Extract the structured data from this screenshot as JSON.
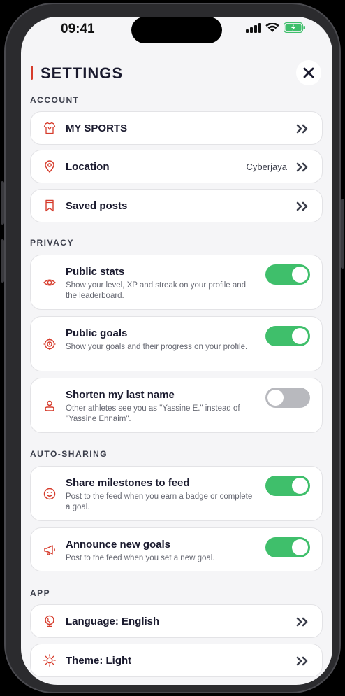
{
  "status": {
    "time": "09:41"
  },
  "header": {
    "title": "SETTINGS"
  },
  "sections": {
    "account": "ACCOUNT",
    "privacy": "PRIVACY",
    "auto_sharing": "AUTO-SHARING",
    "app": "APP"
  },
  "account": {
    "my_sports": {
      "label": "MY SPORTS",
      "icon": "jersey-icon"
    },
    "location": {
      "label": "Location",
      "value": "Cyberjaya",
      "icon": "location-pin-icon"
    },
    "saved_posts": {
      "label": "Saved posts",
      "icon": "bookmark-icon"
    }
  },
  "privacy": {
    "public_stats": {
      "label": "Public stats",
      "desc": "Show your level, XP and streak on your profile and the leaderboard.",
      "enabled": true,
      "icon": "eye-icon"
    },
    "public_goals": {
      "label": "Public goals",
      "desc": "Show your goals and their progress on your profile.",
      "enabled": true,
      "icon": "target-icon"
    },
    "shorten_name": {
      "label": "Shorten my last name",
      "desc": "Other athletes see you as \"Yassine E.\" instead of \"Yassine Ennaim\".",
      "enabled": false,
      "icon": "person-icon"
    }
  },
  "auto_sharing": {
    "share_milestones": {
      "label": "Share milestones to feed",
      "desc": "Post to the feed when you earn a badge or complete a goal.",
      "enabled": true,
      "icon": "smiley-icon"
    },
    "announce_goals": {
      "label": "Announce new goals",
      "desc": "Post to the feed when you set a new goal.",
      "enabled": true,
      "icon": "megaphone-icon"
    }
  },
  "app": {
    "language": {
      "label": "Language: English",
      "icon": "globe-icon"
    },
    "theme": {
      "label": "Theme: Light",
      "icon": "sun-icon"
    }
  },
  "colors": {
    "accent": "#d63b2b",
    "toggle_on": "#3fbf6b",
    "toggle_off": "#b8b9be",
    "text": "#1a1a2e"
  }
}
